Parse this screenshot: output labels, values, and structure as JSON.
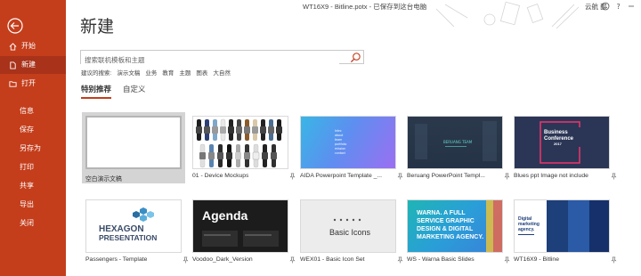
{
  "titlebar": {
    "title": "WT16X9 - Bitline.potx  -  已保存到这台电脑",
    "user": "云航 邵"
  },
  "sidebar": {
    "items": [
      {
        "label": "开始",
        "icon": "home-icon"
      },
      {
        "label": "新建",
        "icon": "new-file-icon"
      },
      {
        "label": "打开",
        "icon": "folder-icon"
      },
      {
        "label": "信息"
      },
      {
        "label": "保存"
      },
      {
        "label": "另存为"
      },
      {
        "label": "打印"
      },
      {
        "label": "共享"
      },
      {
        "label": "导出"
      },
      {
        "label": "关闭"
      }
    ]
  },
  "page": {
    "title": "新建",
    "search_placeholder": "搜索联机模板和主题",
    "suggest_label": "建议的搜索:",
    "suggestions": [
      "演示文稿",
      "业务",
      "教育",
      "主题",
      "图表",
      "大自然"
    ],
    "tabs": [
      "特别推荐",
      "自定义"
    ]
  },
  "templates": [
    {
      "name": "空白演示文稿",
      "pinned": false
    },
    {
      "name": "01 - Device Mockups",
      "pinned": true
    },
    {
      "name": "AIDA Powerpoint Template _...",
      "pinned": true
    },
    {
      "name": "Beruang PowerPoint Templ...",
      "pinned": true
    },
    {
      "name": "Blues ppt Image not include",
      "pinned": true
    },
    {
      "name": "Passengers - Template",
      "pinned": true
    },
    {
      "name": "Voodoo_Dark_Version",
      "pinned": true
    },
    {
      "name": "WEX01 - Basic Icon Set",
      "pinned": true
    },
    {
      "name": "WS - Warna Basic Slides",
      "pinned": true
    },
    {
      "name": "WT16X9 - Bitline",
      "pinned": true
    }
  ],
  "thumbs": {
    "aida_lines": [
      "Intro",
      "about",
      "team",
      "portfolio",
      "mission",
      "contact"
    ],
    "beruang": "BERUANG TEAM",
    "blues": [
      "Business",
      "Conference",
      "2017"
    ],
    "hexagon": [
      "HEXAGON",
      "PRESENTATION"
    ],
    "agenda": "Agenda",
    "basic_icons": "Basic Icons",
    "warna": [
      "WARNA. A FULL",
      "SERVICE GRAPHIC",
      "DESIGN & DIGITAL",
      "MARKETING AGENCY."
    ],
    "bitline": [
      "Digital",
      "marketing",
      "agency."
    ]
  },
  "colors": {
    "accent": "#c43e1c",
    "accent_dark": "#a8321a"
  }
}
